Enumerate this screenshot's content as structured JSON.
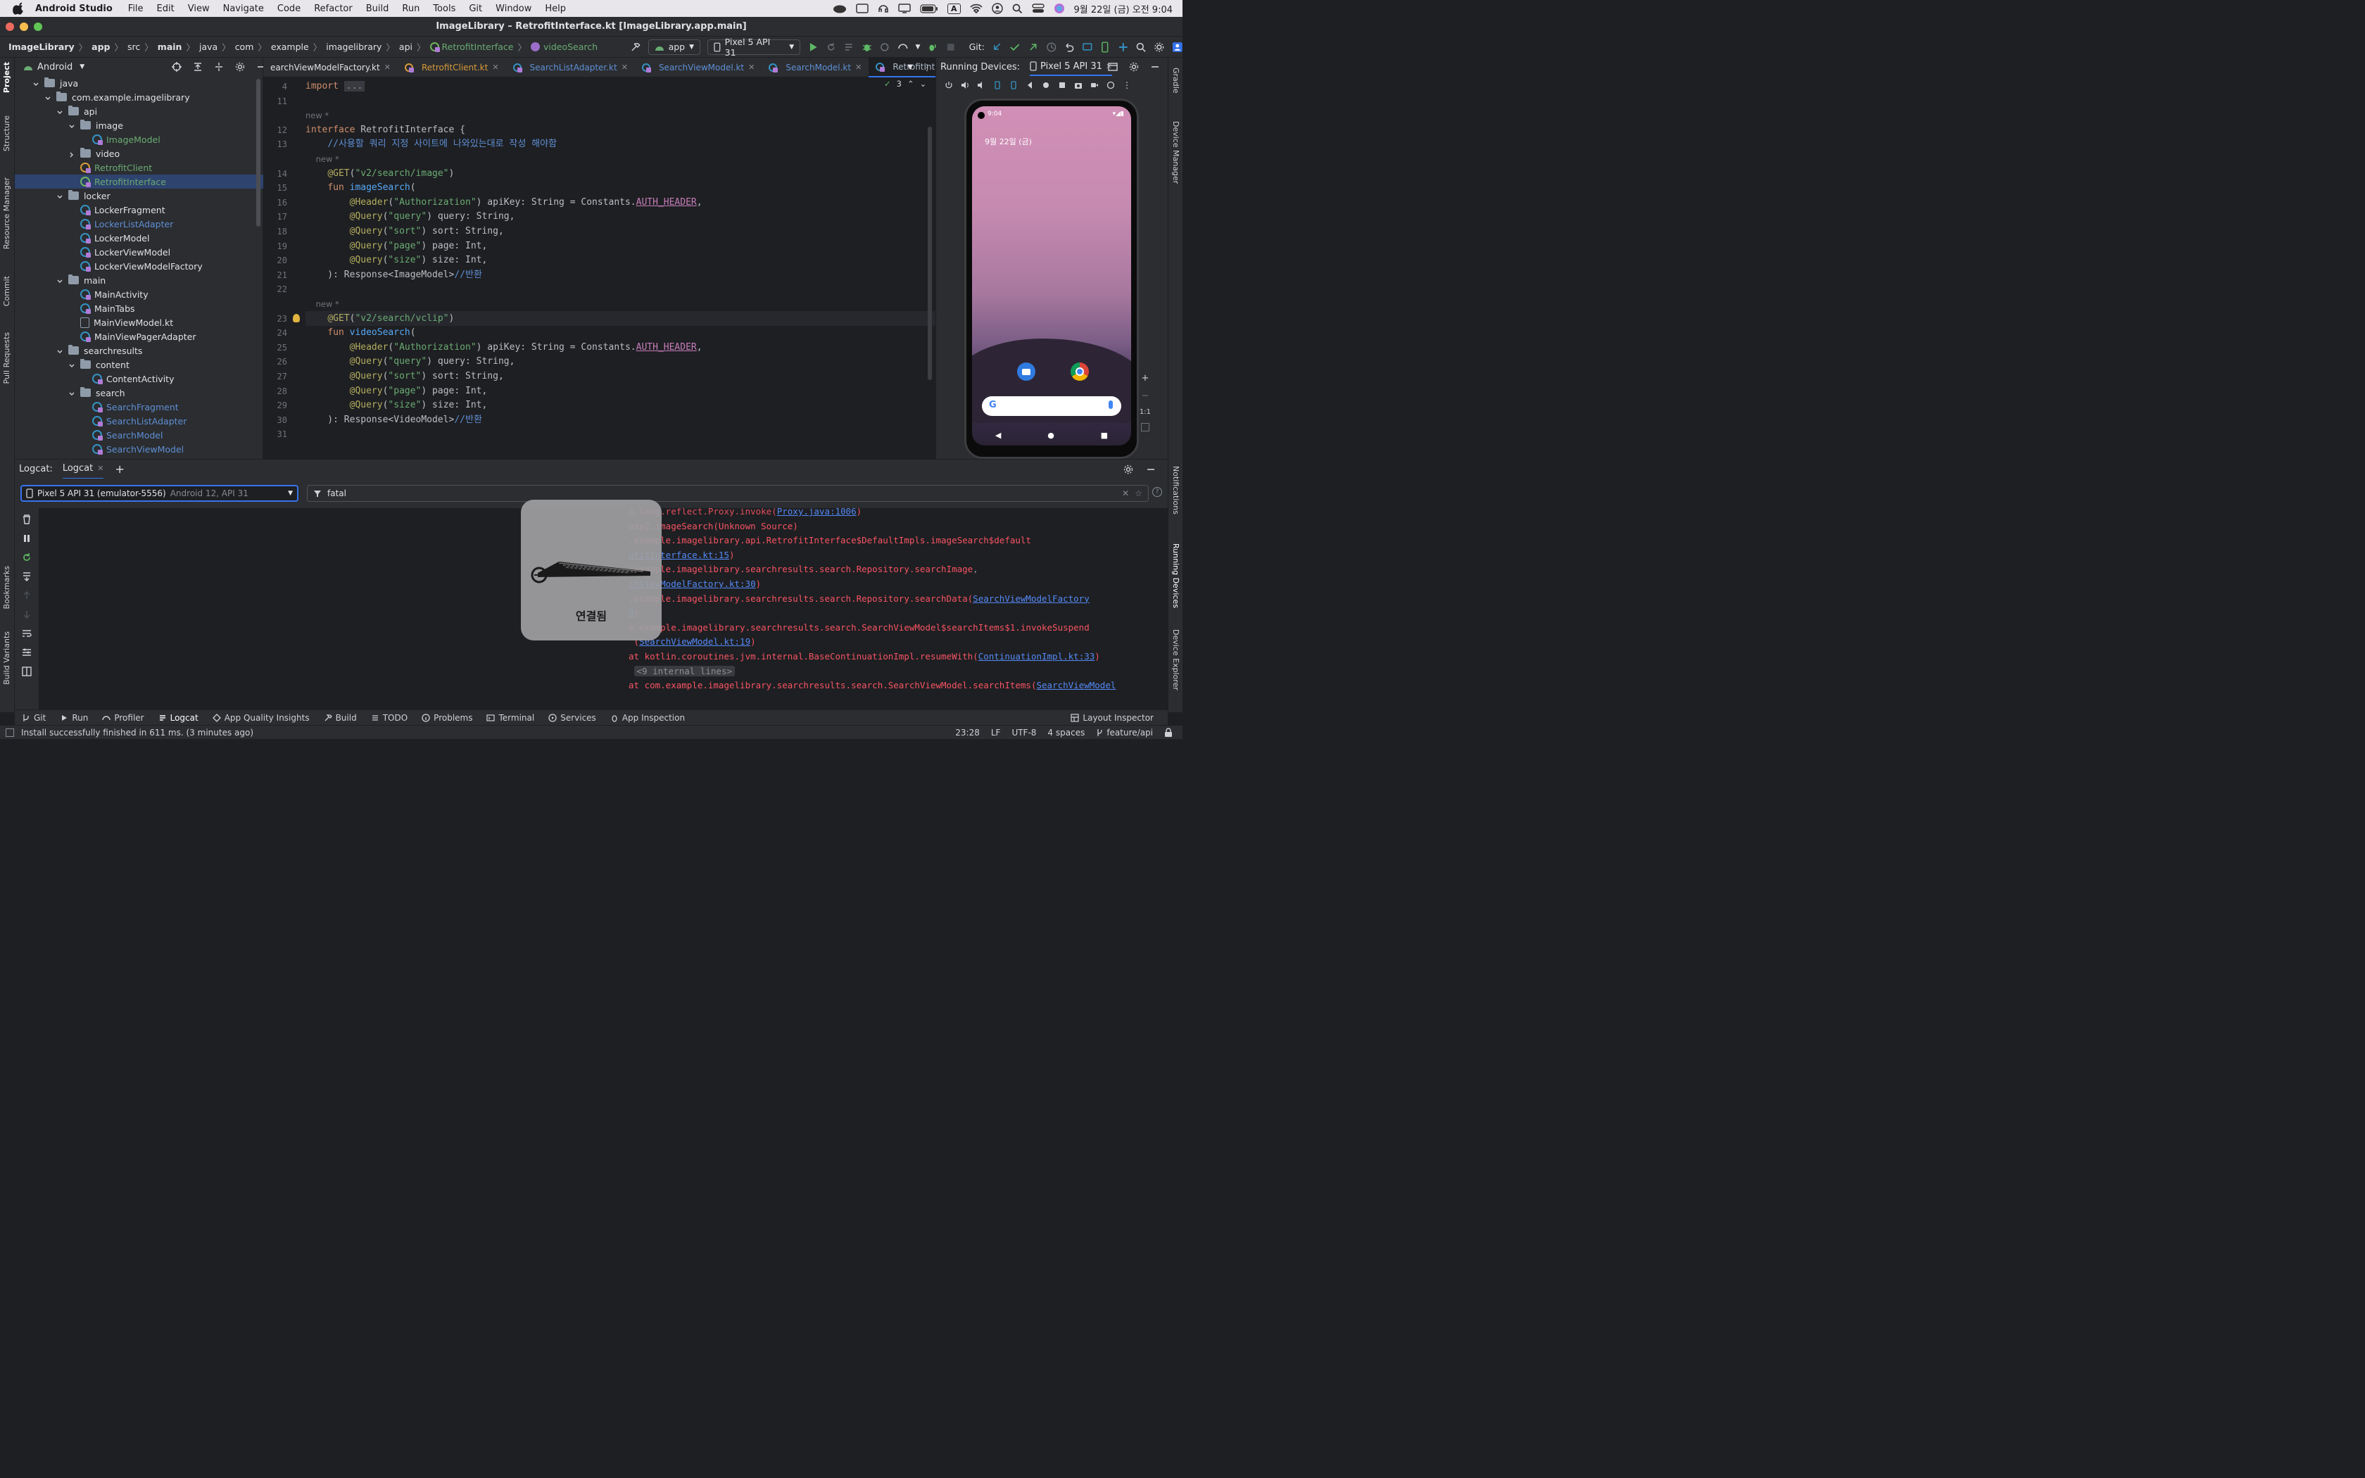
{
  "menubar": {
    "app_name": "Android Studio",
    "items": [
      "File",
      "Edit",
      "View",
      "Navigate",
      "Code",
      "Refactor",
      "Build",
      "Run",
      "Tools",
      "Git",
      "Window",
      "Help"
    ],
    "input_source": "A",
    "clock": "9월 22일 (금) 오전 9:04"
  },
  "window": {
    "title": "ImageLibrary – RetrofitInterface.kt [ImageLibrary.app.main]"
  },
  "navbar": {
    "breadcrumbs": [
      "ImageLibrary",
      "app",
      "src",
      "main",
      "java",
      "com",
      "example",
      "imagelibrary",
      "api",
      "RetrofitInterface",
      "videoSearch"
    ],
    "run_config": "app",
    "device": "Pixel 5 API 31",
    "git_label": "Git:"
  },
  "project": {
    "view_label": "Android",
    "tree": [
      {
        "label": "java",
        "indent": 1,
        "kind": "folder",
        "arrow": "down"
      },
      {
        "label": "com.example.imagelibrary",
        "indent": 2,
        "kind": "folder",
        "arrow": "down"
      },
      {
        "label": "api",
        "indent": 3,
        "kind": "folder",
        "arrow": "down"
      },
      {
        "label": "image",
        "indent": 4,
        "kind": "folder",
        "arrow": "down"
      },
      {
        "label": "ImageModel",
        "indent": 5,
        "kind": "kt-cls",
        "color": "#6aab73"
      },
      {
        "label": "video",
        "indent": 4,
        "kind": "folder",
        "arrow": "right"
      },
      {
        "label": "RetrofitClient",
        "indent": 4,
        "kind": "kt-obj",
        "color": "#6aab73"
      },
      {
        "label": "RetrofitInterface",
        "indent": 4,
        "kind": "kt-itf",
        "color": "#6aab73",
        "selected": true
      },
      {
        "label": "locker",
        "indent": 3,
        "kind": "folder",
        "arrow": "down"
      },
      {
        "label": "LockerFragment",
        "indent": 4,
        "kind": "kt-cls"
      },
      {
        "label": "LockerListAdapter",
        "indent": 4,
        "kind": "kt-cls",
        "color": "#5f8fd5"
      },
      {
        "label": "LockerModel",
        "indent": 4,
        "kind": "kt-cls"
      },
      {
        "label": "LockerViewModel",
        "indent": 4,
        "kind": "kt-cls"
      },
      {
        "label": "LockerViewModelFactory",
        "indent": 4,
        "kind": "kt-cls"
      },
      {
        "label": "main",
        "indent": 3,
        "kind": "folder",
        "arrow": "down"
      },
      {
        "label": "MainActivity",
        "indent": 4,
        "kind": "kt-cls"
      },
      {
        "label": "MainTabs",
        "indent": 4,
        "kind": "kt-cls"
      },
      {
        "label": "MainViewModel.kt",
        "indent": 4,
        "kind": "file"
      },
      {
        "label": "MainViewPagerAdapter",
        "indent": 4,
        "kind": "kt-cls"
      },
      {
        "label": "searchresults",
        "indent": 3,
        "kind": "folder",
        "arrow": "down"
      },
      {
        "label": "content",
        "indent": 4,
        "kind": "folder",
        "arrow": "down"
      },
      {
        "label": "ContentActivity",
        "indent": 5,
        "kind": "kt-cls"
      },
      {
        "label": "search",
        "indent": 4,
        "kind": "folder",
        "arrow": "down"
      },
      {
        "label": "SearchFragment",
        "indent": 5,
        "kind": "kt-cls",
        "color": "#5f8fd5"
      },
      {
        "label": "SearchListAdapter",
        "indent": 5,
        "kind": "kt-cls",
        "color": "#5f8fd5"
      },
      {
        "label": "SearchModel",
        "indent": 5,
        "kind": "kt-cls",
        "color": "#5f8fd5"
      },
      {
        "label": "SearchViewModel",
        "indent": 5,
        "kind": "kt-cls",
        "color": "#5f8fd5"
      }
    ]
  },
  "editor": {
    "tabs": [
      {
        "label": "earchViewModelFactory.kt"
      },
      {
        "label": "RetrofitClient.kt",
        "color": "#d89a3a"
      },
      {
        "label": "SearchListAdapter.kt",
        "color": "#5f8fd5"
      },
      {
        "label": "SearchViewModel.kt",
        "color": "#5f8fd5"
      },
      {
        "label": "SearchModel.kt",
        "color": "#5f8fd5"
      },
      {
        "label": "RetrofitInterface.kt",
        "color": "#5f8fd5",
        "active": true
      }
    ],
    "inspection_count": "3",
    "lines": [
      {
        "n": "4",
        "html": "<span class='kw'>import</span> <span style='background:#393b40;color:#8c8f94;padding:0 3px'>...</span>"
      },
      {
        "n": "11",
        "html": ""
      },
      {
        "hint": "new *"
      },
      {
        "n": "12",
        "html": "<span class='kw'>interface</span> RetrofitInterface {"
      },
      {
        "n": "13",
        "html": "    <span class='cmk'>//사용할 쿼리 지정 사이트에 나와있는대로 작성 해야함</span>"
      },
      {
        "hint": "    new *"
      },
      {
        "n": "14",
        "html": "    <span class='an'>@GET</span>(<span class='st'>\"v2/search/image\"</span>)"
      },
      {
        "n": "15",
        "html": "    <span class='kw'>fun</span> <span class='fn'>imageSearch</span>("
      },
      {
        "n": "16",
        "html": "        <span class='an'>@Header</span>(<span class='st'>\"Authorization\"</span>) apiKey: String = Constants.<span class='cn'>AUTH_HEADER</span>,"
      },
      {
        "n": "17",
        "html": "        <span class='an'>@Query</span>(<span class='st'>\"query\"</span>) query: String,"
      },
      {
        "n": "18",
        "html": "        <span class='an'>@Query</span>(<span class='st'>\"sort\"</span>) sort: String,"
      },
      {
        "n": "19",
        "html": "        <span class='an'>@Query</span>(<span class='st'>\"page\"</span>) page: Int,"
      },
      {
        "n": "20",
        "html": "        <span class='an'>@Query</span>(<span class='st'>\"size\"</span>) size: Int,"
      },
      {
        "n": "21",
        "html": "    ): Response&lt;ImageModel&gt;<span class='cmk'>//반환</span>"
      },
      {
        "n": "22",
        "html": ""
      },
      {
        "hint": "    new *"
      },
      {
        "n": "23",
        "html": "    <span class='an'>@GET</span>(<span class='st'>\"v2/search/vclip\"</span>)",
        "current": true
      },
      {
        "n": "24",
        "html": "    <span class='kw'>fun</span> <span class='fn'>videoSearch</span>("
      },
      {
        "n": "25",
        "html": "        <span class='an'>@Header</span>(<span class='st'>\"Authorization\"</span>) apiKey: String = Constants.<span class='cn'>AUTH_HEADER</span>,"
      },
      {
        "n": "26",
        "html": "        <span class='an'>@Query</span>(<span class='st'>\"query\"</span>) query: String,"
      },
      {
        "n": "27",
        "html": "        <span class='an'>@Query</span>(<span class='st'>\"sort\"</span>) sort: String,"
      },
      {
        "n": "28",
        "html": "        <span class='an'>@Query</span>(<span class='st'>\"page\"</span>) page: Int,"
      },
      {
        "n": "29",
        "html": "        <span class='an'>@Query</span>(<span class='st'>\"size\"</span>) size: Int,"
      },
      {
        "n": "30",
        "html": "    ): Response&lt;VideoModel&gt;<span class='cmk'>//반환</span>"
      },
      {
        "n": "31",
        "html": ""
      }
    ]
  },
  "devices": {
    "title": "Running Devices:",
    "tab": "Pixel 5 API 31",
    "phone_status_time": "9:04",
    "phone_date": "9월 22일 (금)",
    "zoom_label": "1:1"
  },
  "logcat": {
    "title": "Logcat:",
    "tab": "Logcat",
    "device": "Pixel 5 API 31 (emulator-5556)",
    "device_detail": "Android 12, API 31",
    "filter": "fatal",
    "lines": [
      "<span style='opacity:.9'>a.lang.reflect.Proxy.invoke(</span><span class='lk'>Proxy.java:1006</span>)",
      "oxy2.imageSearch(Unknown Source)",
      ".example.imagelibrary.api.RetrofitInterface$DefaultImpls.imageSearch$default",
      "<span class='lk'>ofitInterface.kt:15</span>)",
      ".example.imagelibrary.searchresults.search.Repository.searchImage<span style='color:#8c8f94'>,</span>",
      "<span class='lk'>chViewModelFactory.kt:30</span>)",
      ".example.imagelibrary.searchresults.search.Repository.searchData(<span class='lk'>SearchViewModelFactory</span>",
      "<span class='lk'>8</span>)",
      "m.example.imagelibrary.searchresults.search.SearchViewModel$searchItems$1.invokeSuspend",
      " (<span class='lk'>SearchViewModel.kt:19</span>)",
      "at kotlin.coroutines.jvm.internal.BaseContinuationImpl.resumeWith(<span class='lk'>ContinuationImpl.kt:33</span>)",
      " <span class='gray'>&lt;9 internal lines&gt;</span>",
      "at com.example.imagelibrary.searchresults.search.SearchViewModel.searchItems(<span class='lk'>SearchViewModel</span>"
    ]
  },
  "popup": {
    "label": "연결됨"
  },
  "tool_windows": [
    "Git",
    "Run",
    "Profiler",
    "Logcat",
    "App Quality Insights",
    "Build",
    "TODO",
    "Problems",
    "Terminal",
    "Services",
    "App Inspection"
  ],
  "layout_inspector": "Layout Inspector",
  "left_strip": [
    "Project",
    "Structure",
    "Resource Manager",
    "Commit",
    "Pull Requests",
    "Bookmarks",
    "Build Variants"
  ],
  "right_strip": [
    "Gradle",
    "Device Manager",
    "Notifications",
    "Running Devices",
    "Device Explorer"
  ],
  "status": {
    "message": "Install successfully finished in 611 ms. (3 minutes ago)",
    "position": "23:28",
    "line_sep": "LF",
    "encoding": "UTF-8",
    "indent": "4 spaces",
    "branch": "feature/api"
  }
}
